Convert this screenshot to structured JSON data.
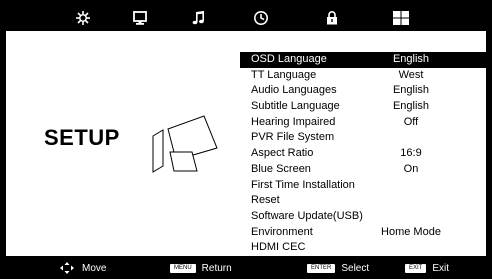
{
  "top_tabs": [
    {
      "icon": "picture-settings-icon"
    },
    {
      "icon": "monitor-icon"
    },
    {
      "icon": "music-note-icon"
    },
    {
      "icon": "clock-icon"
    },
    {
      "icon": "lock-icon"
    },
    {
      "icon": "setup-grid-icon"
    }
  ],
  "page": {
    "title": "SETUP"
  },
  "menu": {
    "items": [
      {
        "label": "OSD Language",
        "value": "English",
        "selected": true
      },
      {
        "label": "TT Language",
        "value": "West"
      },
      {
        "label": "Audio Languages",
        "value": "English"
      },
      {
        "label": "Subtitle Language",
        "value": "English"
      },
      {
        "label": "Hearing Impaired",
        "value": "Off"
      },
      {
        "label": "PVR File System",
        "value": ""
      },
      {
        "label": "Aspect Ratio",
        "value": "16:9"
      },
      {
        "label": "Blue Screen",
        "value": "On"
      },
      {
        "label": "First Time Installation",
        "value": ""
      },
      {
        "label": "Reset",
        "value": ""
      },
      {
        "label": "Software Update(USB)",
        "value": ""
      },
      {
        "label": "Environment",
        "value": "Home Mode"
      },
      {
        "label": "HDMI CEC",
        "value": ""
      }
    ]
  },
  "footer": {
    "move_label": "Move",
    "menu_key": "MENU",
    "return_label": "Return",
    "enter_key": "ENTER",
    "select_label": "Select",
    "exit_key": "EXIT",
    "exit_label": "Exit"
  }
}
